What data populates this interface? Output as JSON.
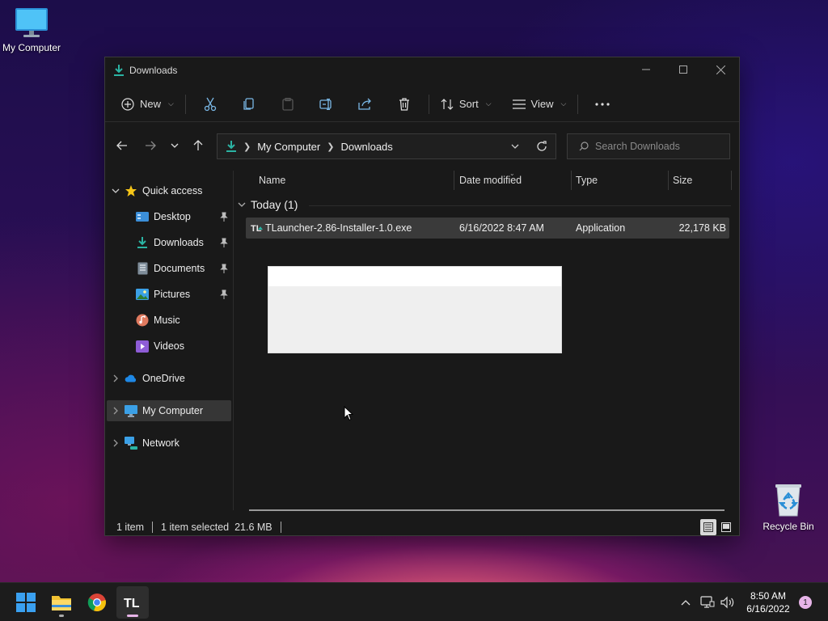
{
  "desktop": {
    "icons": [
      {
        "label": "My Computer"
      },
      {
        "label": "Recycle Bin"
      }
    ]
  },
  "window": {
    "title": "Downloads",
    "toolbar": {
      "new_label": "New",
      "sort_label": "Sort",
      "view_label": "View"
    },
    "address": {
      "crumbs": [
        "My Computer",
        "Downloads"
      ]
    },
    "search": {
      "placeholder": "Search Downloads"
    },
    "sidebar": {
      "quick_access": "Quick access",
      "pinned": [
        "Desktop",
        "Downloads",
        "Documents",
        "Pictures"
      ],
      "music": "Music",
      "videos": "Videos",
      "onedrive": "OneDrive",
      "my_computer": "My Computer",
      "network": "Network"
    },
    "columns": {
      "name": "Name",
      "date": "Date modified",
      "type": "Type",
      "size": "Size"
    },
    "group_header": "Today (1)",
    "files": [
      {
        "name": "TLauncher-2.86-Installer-1.0.exe",
        "date": "6/16/2022 8:47 AM",
        "type": "Application",
        "size": "22,178 KB"
      }
    ],
    "status": {
      "count": "1 item",
      "selected": "1 item selected  21.6 MB"
    }
  },
  "taskbar": {
    "time": "8:50 AM",
    "date": "6/16/2022",
    "notification_count": "1"
  },
  "colors": {
    "accent": "#2bb3a3",
    "window_bg": "#191919",
    "selected_row": "#3a3a3a",
    "taskbar_bg": "#1c1c1c"
  }
}
